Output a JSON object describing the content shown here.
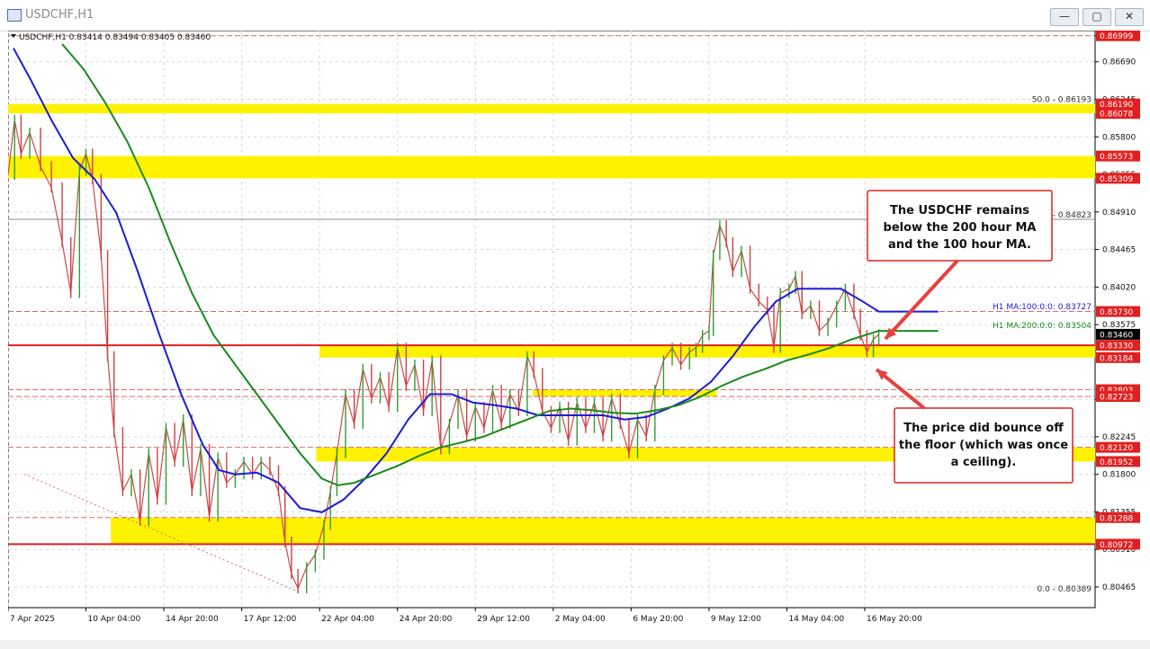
{
  "window": {
    "title": "USDCHF,H1",
    "buttons": [
      "—",
      "▢",
      "✕"
    ]
  },
  "chart_data": {
    "type": "line",
    "symbol_info": "USDCHF,H1  0.83414 0.83494 0.83405 0.83460",
    "ylim": [
      0.8022,
      0.8706
    ],
    "y_ticks": [
      0.86999,
      0.8669,
      0.86245,
      0.858,
      0.85355,
      0.8491,
      0.84465,
      0.8402,
      0.83575,
      0.8269,
      0.82245,
      0.818,
      0.81355,
      0.8091,
      0.80465
    ],
    "x_ticks": [
      "7 Apr 2025",
      "10 Apr 04:00",
      "14 Apr 20:00",
      "17 Apr 12:00",
      "22 Apr 04:00",
      "24 Apr 20:00",
      "29 Apr 12:00",
      "2 May 04:00",
      "6 May 20:00",
      "9 May 12:00",
      "14 May 04:00",
      "16 May 20:00"
    ],
    "x_range": [
      0,
      100
    ],
    "x_tick_positions": [
      0,
      7.2,
      14.4,
      21.6,
      28.8,
      36.0,
      43.2,
      50.4,
      57.6,
      64.8,
      72.0,
      79.2
    ],
    "current_price": 0.8346,
    "price_series": [
      [
        0,
        0.8535
      ],
      [
        0.6,
        0.86
      ],
      [
        1.2,
        0.856
      ],
      [
        2,
        0.8585
      ],
      [
        3,
        0.8545
      ],
      [
        4,
        0.852
      ],
      [
        5,
        0.8455
      ],
      [
        5.8,
        0.8395
      ],
      [
        6.6,
        0.854
      ],
      [
        7.2,
        0.856
      ],
      [
        7.8,
        0.853
      ],
      [
        8.6,
        0.844
      ],
      [
        9.2,
        0.832
      ],
      [
        9.8,
        0.823
      ],
      [
        10.6,
        0.816
      ],
      [
        11.4,
        0.818
      ],
      [
        12.2,
        0.8125
      ],
      [
        13,
        0.8205
      ],
      [
        13.8,
        0.815
      ],
      [
        14.6,
        0.8235
      ],
      [
        15.4,
        0.8195
      ],
      [
        16.2,
        0.8245
      ],
      [
        17,
        0.816
      ],
      [
        17.8,
        0.821
      ],
      [
        18.6,
        0.813
      ],
      [
        19.4,
        0.82
      ],
      [
        20.2,
        0.817
      ],
      [
        21,
        0.818
      ],
      [
        21.8,
        0.8195
      ],
      [
        22.6,
        0.818
      ],
      [
        23.4,
        0.8195
      ],
      [
        24.2,
        0.8185
      ],
      [
        25,
        0.816
      ],
      [
        25.6,
        0.81
      ],
      [
        26.2,
        0.8062
      ],
      [
        26.8,
        0.8045
      ],
      [
        27.6,
        0.807
      ],
      [
        28.4,
        0.8085
      ],
      [
        29.2,
        0.812
      ],
      [
        29.8,
        0.816
      ],
      [
        30.4,
        0.8205
      ],
      [
        31.2,
        0.8275
      ],
      [
        32,
        0.824
      ],
      [
        32.8,
        0.8305
      ],
      [
        33.6,
        0.827
      ],
      [
        34.4,
        0.8295
      ],
      [
        35.2,
        0.826
      ],
      [
        36,
        0.833
      ],
      [
        36.8,
        0.8285
      ],
      [
        37.6,
        0.831
      ],
      [
        38.4,
        0.8255
      ],
      [
        39.2,
        0.8315
      ],
      [
        40,
        0.821
      ],
      [
        40.8,
        0.824
      ],
      [
        41.6,
        0.8275
      ],
      [
        42.4,
        0.8225
      ],
      [
        43.2,
        0.826
      ],
      [
        44,
        0.8235
      ],
      [
        44.8,
        0.828
      ],
      [
        45.6,
        0.824
      ],
      [
        46.4,
        0.8275
      ],
      [
        47.2,
        0.8255
      ],
      [
        48,
        0.832
      ],
      [
        48.6,
        0.83
      ],
      [
        49.4,
        0.8255
      ],
      [
        50.2,
        0.8235
      ],
      [
        51,
        0.826
      ],
      [
        51.8,
        0.822
      ],
      [
        52.6,
        0.8265
      ],
      [
        53.4,
        0.8235
      ],
      [
        54.2,
        0.8265
      ],
      [
        55,
        0.8225
      ],
      [
        55.8,
        0.827
      ],
      [
        56.6,
        0.824
      ],
      [
        57.4,
        0.8205
      ],
      [
        58.2,
        0.8245
      ],
      [
        59,
        0.8225
      ],
      [
        59.8,
        0.828
      ],
      [
        60.6,
        0.8315
      ],
      [
        61.4,
        0.833
      ],
      [
        62.2,
        0.831
      ],
      [
        63,
        0.8325
      ],
      [
        63.6,
        0.833
      ],
      [
        64.2,
        0.8345
      ],
      [
        64.8,
        0.835
      ],
      [
        65.2,
        0.844
      ],
      [
        65.8,
        0.8475
      ],
      [
        66.4,
        0.8455
      ],
      [
        67,
        0.842
      ],
      [
        67.8,
        0.8445
      ],
      [
        68.6,
        0.84
      ],
      [
        69.4,
        0.8385
      ],
      [
        70.2,
        0.8375
      ],
      [
        70.8,
        0.833
      ],
      [
        71.4,
        0.8395
      ],
      [
        72.2,
        0.84
      ],
      [
        72.8,
        0.8415
      ],
      [
        73.4,
        0.837
      ],
      [
        74.2,
        0.838
      ],
      [
        75,
        0.835
      ],
      [
        75.8,
        0.836
      ],
      [
        76.6,
        0.838
      ],
      [
        77.4,
        0.84
      ],
      [
        78.2,
        0.837
      ],
      [
        78.8,
        0.8345
      ],
      [
        79.4,
        0.8325
      ],
      [
        80,
        0.834
      ],
      [
        80.5,
        0.8346
      ]
    ],
    "series": [
      {
        "name": "H1 MA:100:0:0: 0.83727",
        "color": "#1c1cd6",
        "label_y": 0.83727,
        "values": [
          [
            0.5,
            0.8685
          ],
          [
            2,
            0.865
          ],
          [
            4,
            0.86
          ],
          [
            6,
            0.8555
          ],
          [
            8,
            0.853
          ],
          [
            10,
            0.849
          ],
          [
            12,
            0.842
          ],
          [
            14,
            0.8345
          ],
          [
            16,
            0.8275
          ],
          [
            18,
            0.8215
          ],
          [
            19.5,
            0.8185
          ],
          [
            21,
            0.818
          ],
          [
            23,
            0.8182
          ],
          [
            25,
            0.817
          ],
          [
            27,
            0.814
          ],
          [
            29,
            0.8135
          ],
          [
            31,
            0.815
          ],
          [
            33,
            0.8175
          ],
          [
            35,
            0.8205
          ],
          [
            37,
            0.8245
          ],
          [
            39,
            0.8275
          ],
          [
            41,
            0.8275
          ],
          [
            43,
            0.8265
          ],
          [
            45,
            0.8262
          ],
          [
            47,
            0.8258
          ],
          [
            49,
            0.825
          ],
          [
            51,
            0.825
          ],
          [
            53,
            0.825
          ],
          [
            55,
            0.825
          ],
          [
            57,
            0.8245
          ],
          [
            59,
            0.8248
          ],
          [
            61,
            0.8258
          ],
          [
            63,
            0.827
          ],
          [
            65,
            0.829
          ],
          [
            67,
            0.832
          ],
          [
            69,
            0.8355
          ],
          [
            71,
            0.8385
          ],
          [
            73,
            0.84
          ],
          [
            75,
            0.84
          ],
          [
            77,
            0.84
          ],
          [
            79,
            0.8385
          ],
          [
            80.5,
            0.8373
          ],
          [
            86,
            0.8373
          ]
        ]
      },
      {
        "name": "H1 MA:200:0:0: 0.83504",
        "color": "#1b8a1b",
        "label_y": 0.83504,
        "values": [
          [
            5,
            0.869
          ],
          [
            7,
            0.866
          ],
          [
            9,
            0.862
          ],
          [
            11,
            0.8575
          ],
          [
            13,
            0.852
          ],
          [
            15,
            0.8455
          ],
          [
            17,
            0.8395
          ],
          [
            19,
            0.8345
          ],
          [
            21,
            0.831
          ],
          [
            23,
            0.8275
          ],
          [
            25,
            0.824
          ],
          [
            27,
            0.8205
          ],
          [
            29,
            0.8175
          ],
          [
            30.5,
            0.8167
          ],
          [
            32,
            0.817
          ],
          [
            34,
            0.818
          ],
          [
            36,
            0.819
          ],
          [
            38,
            0.8202
          ],
          [
            40,
            0.8212
          ],
          [
            42,
            0.8218
          ],
          [
            44,
            0.8225
          ],
          [
            46,
            0.8235
          ],
          [
            48,
            0.8245
          ],
          [
            50,
            0.8255
          ],
          [
            52,
            0.8258
          ],
          [
            54,
            0.8256
          ],
          [
            56,
            0.8253
          ],
          [
            58,
            0.8252
          ],
          [
            60,
            0.8256
          ],
          [
            62,
            0.8262
          ],
          [
            64,
            0.8272
          ],
          [
            66,
            0.8285
          ],
          [
            68,
            0.8296
          ],
          [
            70,
            0.8305
          ],
          [
            72,
            0.8315
          ],
          [
            74,
            0.8322
          ],
          [
            76,
            0.833
          ],
          [
            78,
            0.834
          ],
          [
            80.5,
            0.835
          ],
          [
            86,
            0.835
          ]
        ]
      }
    ],
    "zones": [
      {
        "from": 0.86078,
        "to": 0.8619
      },
      {
        "from": 0.85309,
        "to": 0.85573
      },
      {
        "from": 0.83184,
        "to": 0.8333,
        "x_start": 28.8
      },
      {
        "from": 0.82723,
        "to": 0.82803,
        "x_start": 48.5,
        "x_end": 65.5
      },
      {
        "from": 0.81952,
        "to": 0.8212,
        "x_start": 28.5
      },
      {
        "from": 0.80972,
        "to": 0.81288,
        "x_start": 9.5
      }
    ],
    "red_lines": [
      0.8333,
      0.80972
    ],
    "dashed_levels": [
      0.8373,
      0.82803,
      0.82723,
      0.8212,
      0.81288
    ],
    "gray_level": 0.84823,
    "fib_labels": [
      {
        "text": "50.0 - 0.86193",
        "value": 0.86193
      },
      {
        "text": ".2 - 0.84823",
        "value": 0.84823
      },
      {
        "text": "0.0 - 0.80389",
        "value": 0.80389
      }
    ],
    "price_badges": [
      {
        "text": "0.86999",
        "value": 0.86999
      },
      {
        "text": "0.86190",
        "value": 0.8619
      },
      {
        "text": "0.86078",
        "value": 0.86078
      },
      {
        "text": "0.85573",
        "value": 0.85573
      },
      {
        "text": "0.85309",
        "value": 0.85309
      },
      {
        "text": "0.83730",
        "value": 0.8373
      },
      {
        "text": "0.83330",
        "value": 0.8333
      },
      {
        "text": "0.83184",
        "value": 0.83184
      },
      {
        "text": "0.82803",
        "value": 0.82803
      },
      {
        "text": "0.82723",
        "value": 0.82723
      },
      {
        "text": "0.82120",
        "value": 0.8212
      },
      {
        "text": "0.81952",
        "value": 0.81952
      },
      {
        "text": "0.81288",
        "value": 0.81288
      },
      {
        "text": "0.80972",
        "value": 0.80972
      }
    ],
    "annotations": [
      {
        "lines": [
          "The USDCHF remains",
          "below the 200 hour MA",
          "and the 100 hour MA."
        ]
      },
      {
        "lines": [
          "The price did bounce off",
          "the floor (which was once",
          "a ceiling)."
        ]
      }
    ]
  }
}
